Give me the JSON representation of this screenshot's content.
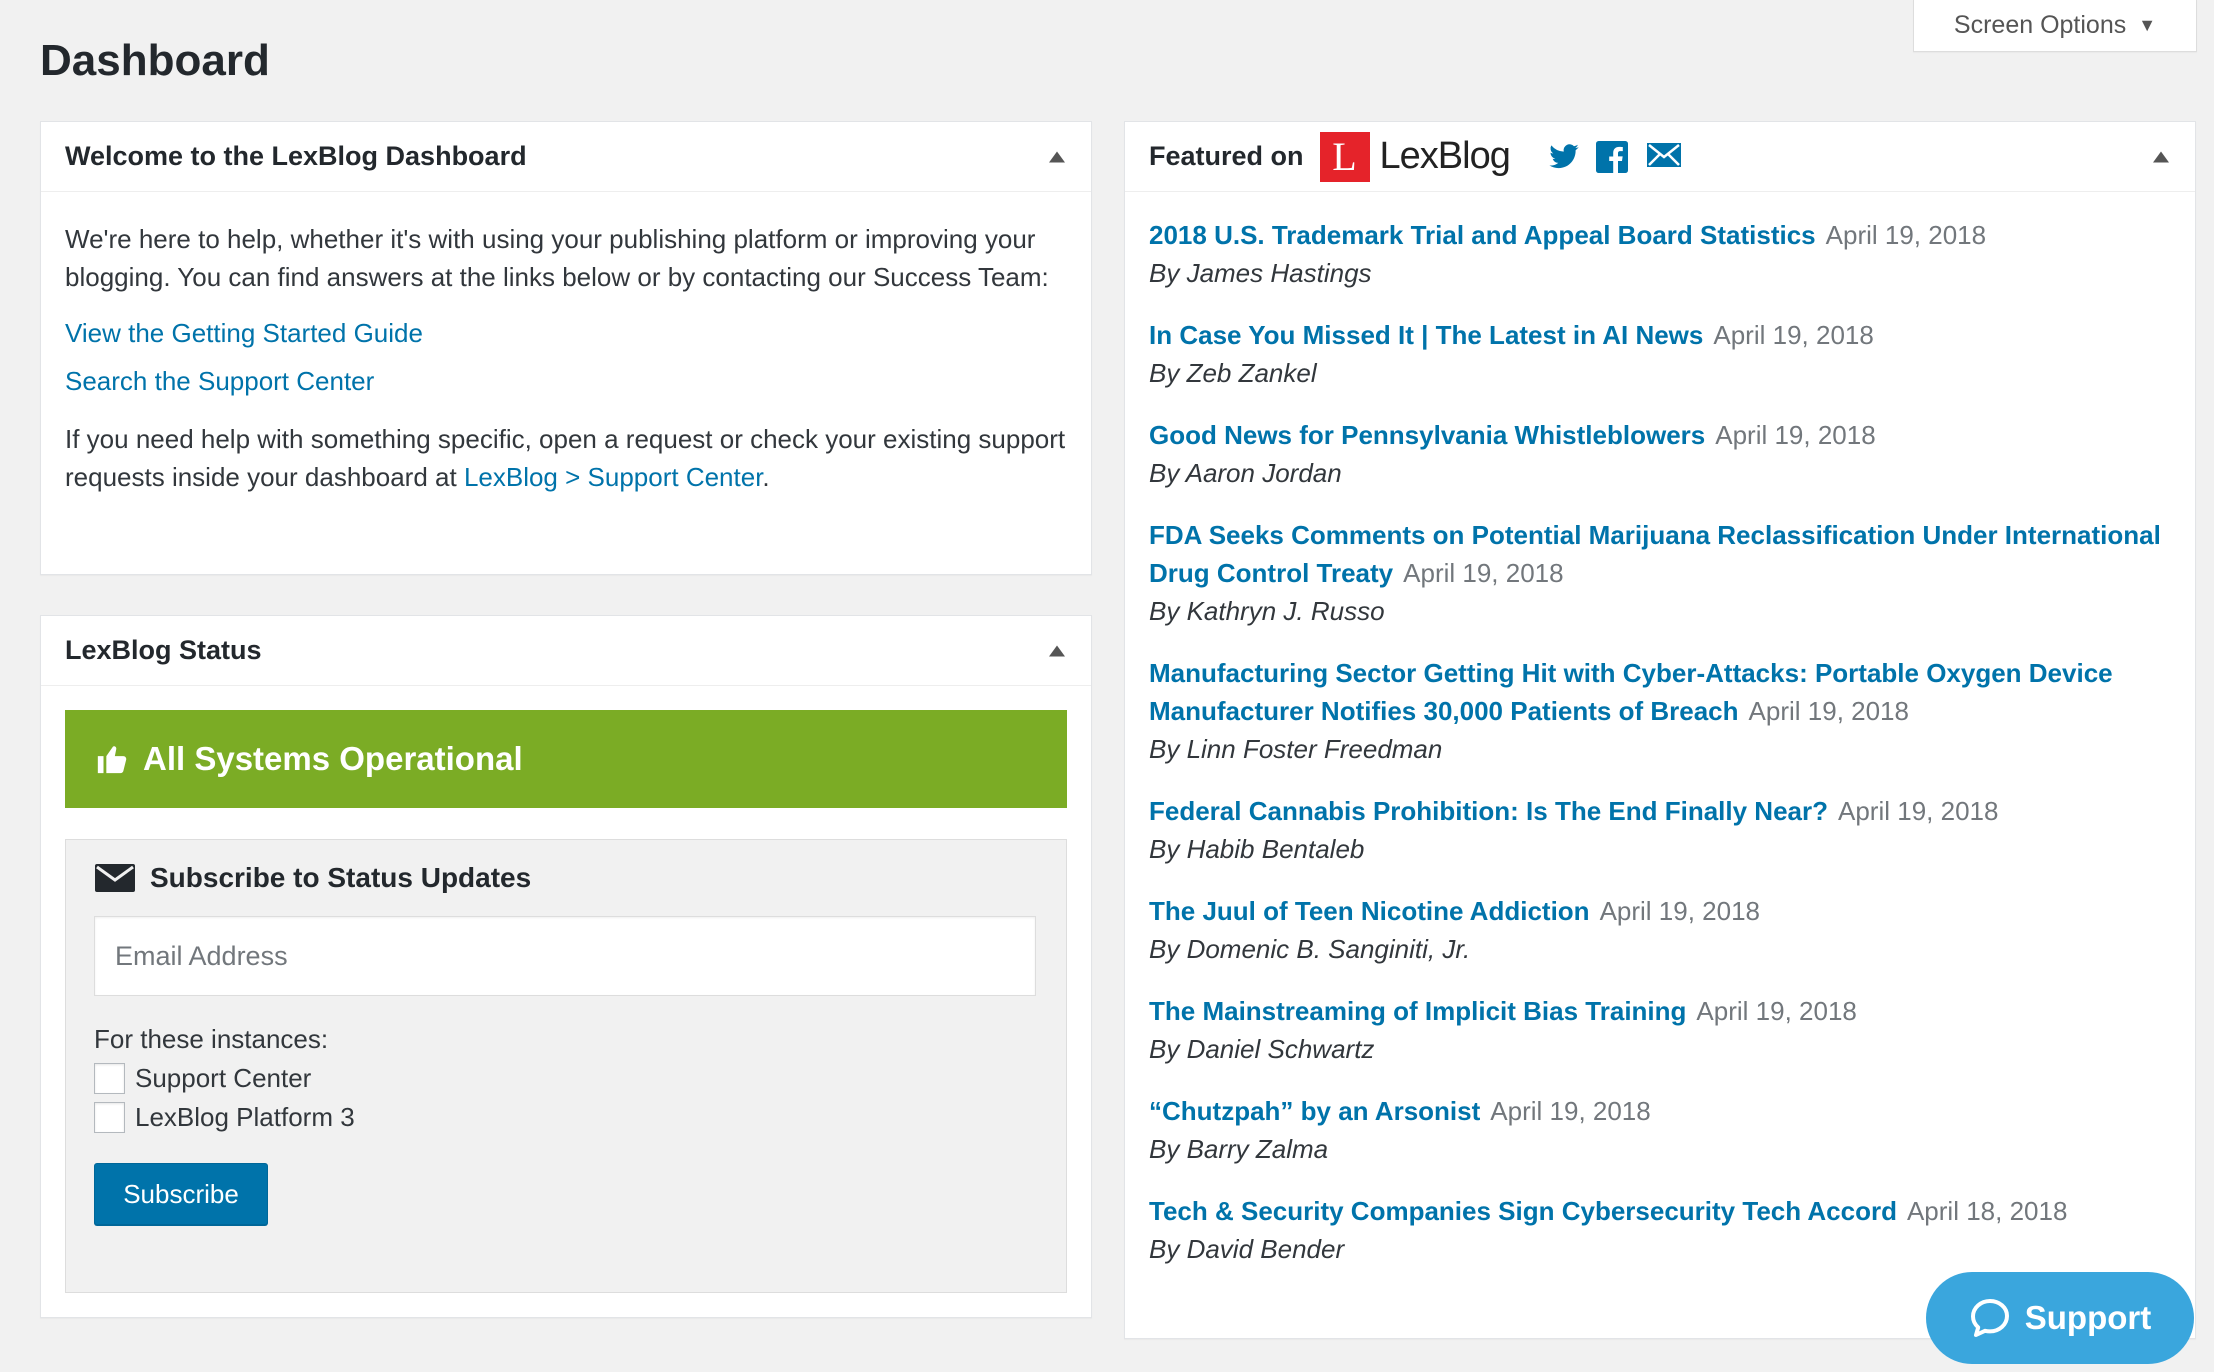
{
  "screen_options": {
    "label": "Screen Options"
  },
  "page": {
    "title": "Dashboard"
  },
  "welcome": {
    "title": "Welcome to the LexBlog Dashboard",
    "intro": "We're here to help, whether it's with using your publishing platform or improving your blogging. You can find answers at the links below or by contacting our Success Team:",
    "link_guide": "View the Getting Started Guide",
    "link_support": "Search the Support Center",
    "help_text": "If you need help with something specific, open a request or check your existing support requests inside your dashboard at",
    "help_link": "LexBlog > Support Center",
    "help_end": "."
  },
  "status": {
    "title": "LexBlog Status",
    "banner": "All Systems Operational",
    "subscribe_heading": "Subscribe to Status Updates",
    "email_placeholder": "Email Address",
    "instances_label": "For these instances:",
    "instances": [
      "Support Center",
      "LexBlog Platform 3"
    ],
    "subscribe_button": "Subscribe",
    "banner_color": "#7bac25"
  },
  "featured": {
    "label": "Featured on",
    "logo_letter": "L",
    "logo_text": "LexBlog",
    "items": [
      {
        "title": "2018 U.S. Trademark Trial and Appeal Board Statistics",
        "date": "April 19, 2018",
        "author": "By James Hastings"
      },
      {
        "title": "In Case You Missed It | The Latest in AI News",
        "date": "April 19, 2018",
        "author": "By Zeb Zankel"
      },
      {
        "title": "Good News for Pennsylvania Whistleblowers",
        "date": "April 19, 2018",
        "author": "By Aaron Jordan"
      },
      {
        "title": "FDA Seeks Comments on Potential Marijuana Reclassification Under International Drug Control Treaty",
        "date": "April 19, 2018",
        "author": "By Kathryn J. Russo"
      },
      {
        "title": "Manufacturing Sector Getting Hit with Cyber-Attacks: Portable Oxygen Device Manufacturer Notifies 30,000 Patients of Breach",
        "date": "April 19, 2018",
        "author": "By Linn Foster Freedman"
      },
      {
        "title": "Federal Cannabis Prohibition: Is The End Finally Near?",
        "date": "April 19, 2018",
        "author": "By Habib Bentaleb"
      },
      {
        "title": "The Juul of Teen Nicotine Addiction",
        "date": "April 19, 2018",
        "author": "By Domenic B. Sanginiti, Jr."
      },
      {
        "title": "The Mainstreaming of Implicit Bias Training",
        "date": "April 19, 2018",
        "author": "By Daniel Schwartz"
      },
      {
        "title": "“Chutzpah” by an Arsonist",
        "date": "April 19, 2018",
        "author": "By Barry Zalma"
      },
      {
        "title": "Tech & Security Companies Sign Cybersecurity Tech Accord",
        "date": "April 18, 2018",
        "author": "By David Bender"
      }
    ]
  },
  "support": {
    "label": "Support",
    "color": "#3aa6dd"
  },
  "colors": {
    "link": "#0073aa",
    "brand_red": "#e5232a"
  }
}
